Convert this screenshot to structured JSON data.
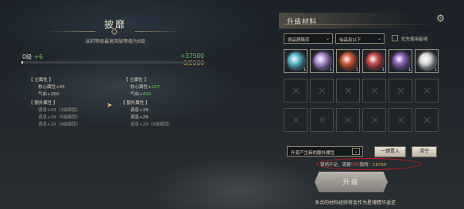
{
  "left": {
    "title": "披靡",
    "subtitle": "当前等级最高突破等级为6级",
    "level": {
      "current": "0级",
      "gain": "+6",
      "exp_gain": "+37500",
      "exp_now": "0/2000",
      "progress": 0.01
    },
    "before": {
      "main_header": "【 主属性 】",
      "main_attrs": [
        "核心属性+65",
        "气血+260"
      ],
      "extra_header": "【 额外属性 】",
      "extra_attrs": [
        "调息+29（3级解锁）",
        "调息+29（6级解锁）",
        "调息+29（9级解锁）"
      ]
    },
    "arrow": "➤",
    "after": {
      "main_header": "【 主属性 】",
      "main_attrs": [
        {
          "label": "核心属性+",
          "value": "107"
        },
        {
          "label": "气血+",
          "value": "434"
        }
      ],
      "extra_header": "【 额外属性 】",
      "extra_attrs": [
        "调息+29",
        "调息+29",
        "调息+29（9级解锁）"
      ]
    }
  },
  "materials": {
    "header": "升级材料",
    "settings_icon": "⚙",
    "sort": {
      "value": "按品质降序",
      "icon": "⌄"
    },
    "filter": {
      "value": "仙品及以下",
      "icon": "⌄"
    },
    "prefer_label": "优先使用星魂",
    "items": [
      {
        "badge": "1",
        "icon": "cyan-orb-icon",
        "color": "#5ab8c8"
      },
      {
        "badge": "1",
        "icon": "violet-orb-icon",
        "color": "#b08cd8"
      },
      {
        "badge": "1",
        "icon": "fire-orb-icon",
        "color": "#d05a38"
      },
      {
        "badge": "1",
        "icon": "red-orb-icon",
        "color": "#c84848"
      },
      {
        "badge": "1",
        "icon": "purple-orb-icon",
        "color": "#8a62b8"
      },
      {
        "badge": "1",
        "icon": "white-orb-icon",
        "color": "#d8d8d8"
      }
    ],
    "attr_select": {
      "value": "升变产生新的额外属性",
      "icon": "⌄"
    },
    "fill_button": "一键置入",
    "clear_button": "清空",
    "warning": {
      "text1": "银两不足，需要",
      "highlight": "扣除",
      "text2": "银两：",
      "amount": "18750"
    },
    "upgrade_button": "升级",
    "footer": "多余的材料经验将会作为星魂精华返还"
  }
}
